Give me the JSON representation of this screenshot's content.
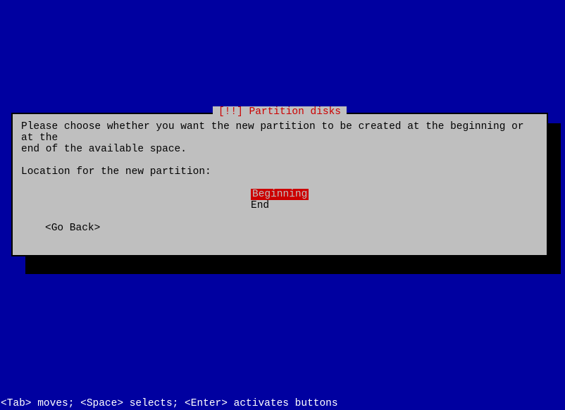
{
  "dialog": {
    "title": "[!!] Partition disks",
    "instruction": "Please choose whether you want the new partition to be created at the beginning or at the\nend of the available space.",
    "prompt": "Location for the new partition:",
    "options": [
      {
        "label": "Beginning",
        "selected": true
      },
      {
        "label": "End",
        "selected": false
      }
    ],
    "go_back": "<Go Back>"
  },
  "help_text": "<Tab> moves; <Space> selects; <Enter> activates buttons"
}
